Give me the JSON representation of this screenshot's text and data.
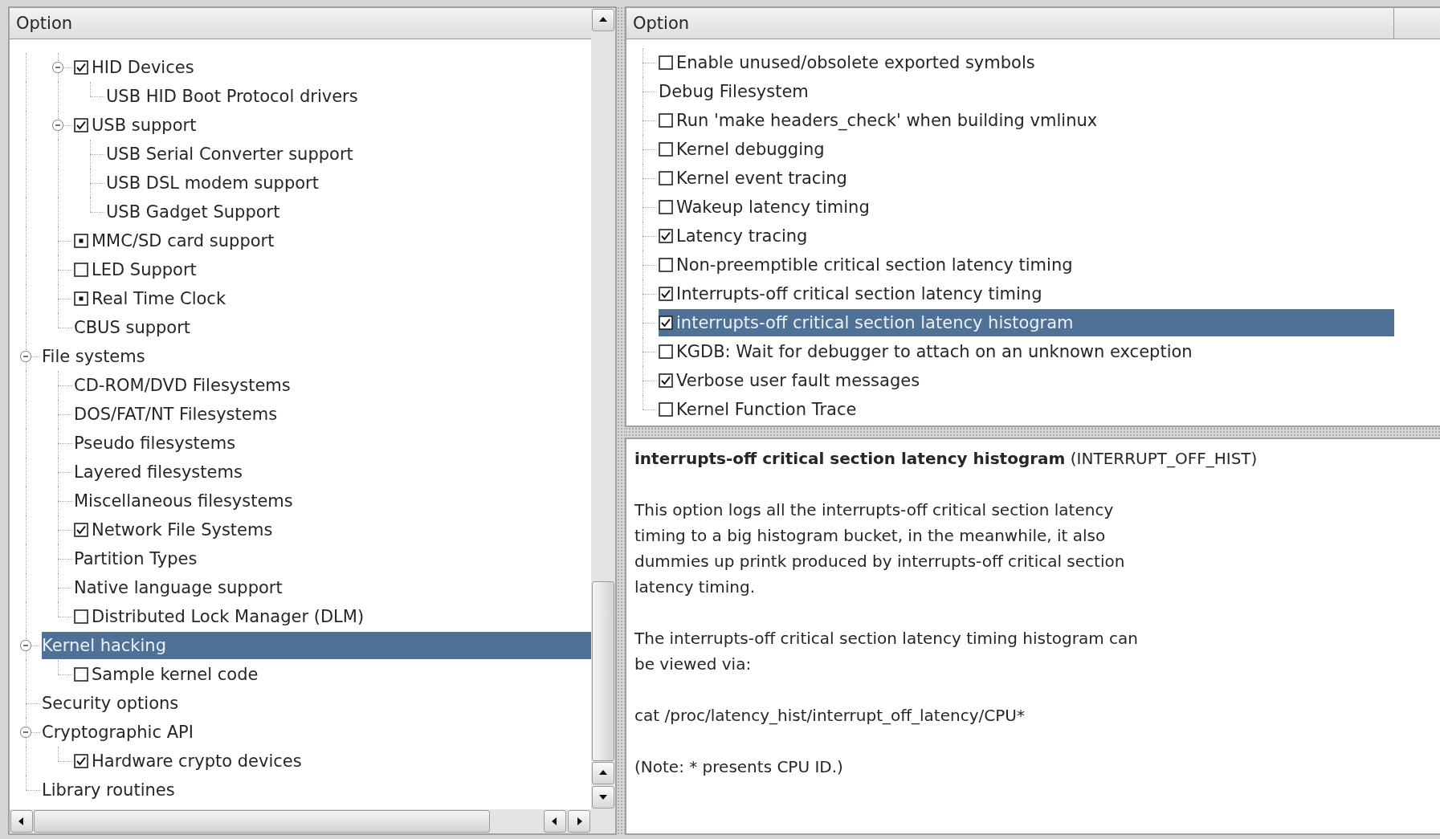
{
  "left_panel": {
    "header": "Option",
    "scrolled_branch_children": [
      {
        "label": "HID Devices",
        "kind": "check",
        "checked": true,
        "selected": false,
        "expanded": true,
        "children": [
          {
            "label": "USB HID Boot Protocol drivers",
            "kind": "menu",
            "selected": false
          }
        ]
      },
      {
        "label": "USB support",
        "kind": "check",
        "checked": true,
        "selected": false,
        "expanded": true,
        "children": [
          {
            "label": "USB Serial Converter support",
            "kind": "menu",
            "selected": false
          },
          {
            "label": "USB DSL modem support",
            "kind": "menu",
            "selected": false
          },
          {
            "label": "USB Gadget Support",
            "kind": "menu",
            "selected": false
          }
        ]
      },
      {
        "label": "MMC/SD card support",
        "kind": "module",
        "checked": true,
        "selected": false
      },
      {
        "label": "LED Support",
        "kind": "check",
        "checked": false,
        "selected": false
      },
      {
        "label": "Real Time Clock",
        "kind": "module",
        "checked": true,
        "selected": false
      },
      {
        "label": "CBUS support",
        "kind": "menu",
        "selected": false
      }
    ],
    "items": [
      {
        "label": "File systems",
        "kind": "menu",
        "selected": false,
        "expanded": true,
        "children": [
          {
            "label": "CD-ROM/DVD Filesystems",
            "kind": "menu",
            "selected": false
          },
          {
            "label": "DOS/FAT/NT Filesystems",
            "kind": "menu",
            "selected": false
          },
          {
            "label": "Pseudo filesystems",
            "kind": "menu",
            "selected": false
          },
          {
            "label": "Layered filesystems",
            "kind": "menu",
            "selected": false
          },
          {
            "label": "Miscellaneous filesystems",
            "kind": "menu",
            "selected": false
          },
          {
            "label": "Network File Systems",
            "kind": "check",
            "checked": true,
            "selected": false
          },
          {
            "label": "Partition Types",
            "kind": "menu",
            "selected": false
          },
          {
            "label": "Native language support",
            "kind": "menu",
            "selected": false
          },
          {
            "label": "Distributed Lock Manager (DLM)",
            "kind": "check",
            "checked": false,
            "selected": false
          }
        ]
      },
      {
        "label": "Kernel hacking",
        "kind": "menu",
        "selected": true,
        "expanded": true,
        "children": [
          {
            "label": "Sample kernel code",
            "kind": "check",
            "checked": false,
            "selected": false
          }
        ]
      },
      {
        "label": "Security options",
        "kind": "menu",
        "selected": false
      },
      {
        "label": "Cryptographic API",
        "kind": "menu",
        "selected": false,
        "expanded": true,
        "children": [
          {
            "label": "Hardware crypto devices",
            "kind": "check",
            "checked": true,
            "selected": false
          }
        ]
      },
      {
        "label": "Library routines",
        "kind": "menu",
        "selected": false
      }
    ]
  },
  "right_panel": {
    "header": "Option",
    "options": [
      {
        "label": "Enable unused/obsolete exported symbols",
        "kind": "check",
        "checked": false,
        "selected": false
      },
      {
        "label": "Debug Filesystem",
        "kind": "menu",
        "selected": false
      },
      {
        "label": "Run 'make headers_check' when building vmlinux",
        "kind": "check",
        "checked": false,
        "selected": false
      },
      {
        "label": "Kernel debugging",
        "kind": "check",
        "checked": false,
        "selected": false
      },
      {
        "label": "Kernel event tracing",
        "kind": "check",
        "checked": false,
        "selected": false
      },
      {
        "label": "Wakeup latency timing",
        "kind": "check",
        "checked": false,
        "selected": false
      },
      {
        "label": "Latency tracing",
        "kind": "check",
        "checked": true,
        "selected": false
      },
      {
        "label": "Non-preemptible critical section latency timing",
        "kind": "check",
        "checked": false,
        "selected": false
      },
      {
        "label": "Interrupts-off critical section latency timing",
        "kind": "check",
        "checked": true,
        "selected": false
      },
      {
        "label": "interrupts-off critical section latency histogram",
        "kind": "check",
        "checked": true,
        "selected": true
      },
      {
        "label": "KGDB: Wait for debugger to attach on an unknown exception",
        "kind": "check",
        "checked": false,
        "selected": false
      },
      {
        "label": "Verbose user fault messages",
        "kind": "check",
        "checked": true,
        "selected": false
      },
      {
        "label": "Kernel Function Trace",
        "kind": "check",
        "checked": false,
        "selected": false
      }
    ]
  },
  "help": {
    "title": "interrupts-off critical section latency histogram",
    "symbol": "(INTERRUPT_OFF_HIST)",
    "paragraphs": [
      "This option logs all the interrupts-off critical section latency\ntiming to a big histogram bucket, in the meanwhile, it also\ndummies up printk produced by interrupts-off critical section\nlatency timing.",
      "The interrupts-off critical section latency timing histogram can\nbe viewed via:",
      "cat /proc/latency_hist/interrupt_off_latency/CPU*",
      "(Note: * presents CPU ID.)"
    ]
  }
}
